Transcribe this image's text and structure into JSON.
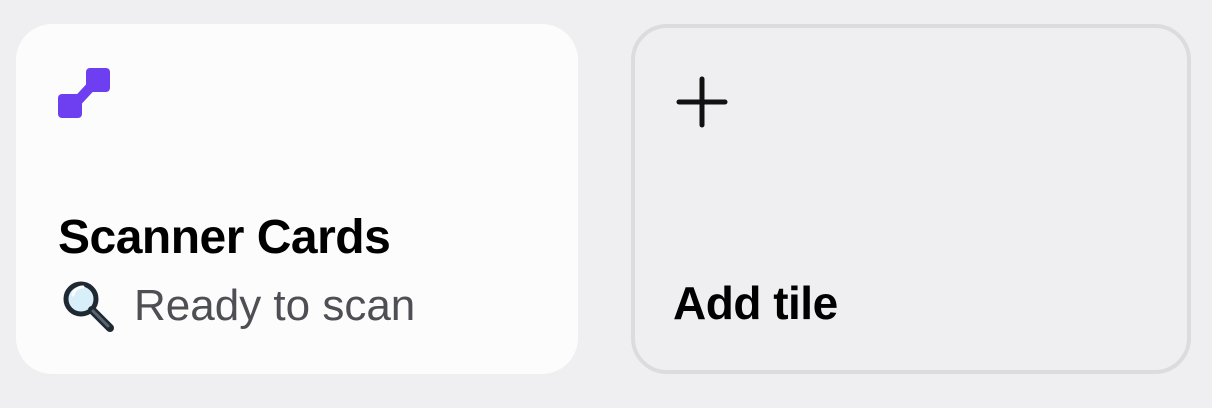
{
  "tiles": [
    {
      "title": "Scanner Cards",
      "status_text": "Ready to scan",
      "icon": "purple-step-icon",
      "status_icon": "magnifying-glass-emoji",
      "accent_color": "#6d3ff0"
    }
  ],
  "add_tile": {
    "label": "Add tile",
    "icon": "plus-icon"
  }
}
